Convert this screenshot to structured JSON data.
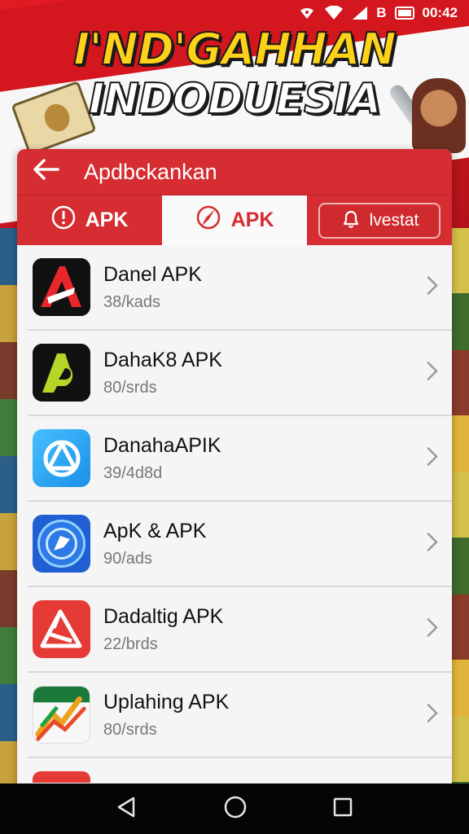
{
  "status_bar": {
    "carrier_glyph": "B",
    "time": "00:42"
  },
  "banner": {
    "line1": "I'ND'GAHHAN",
    "line2": "INDODUESIA"
  },
  "app_bar": {
    "title": "Apdbckankan"
  },
  "tabs": [
    {
      "label": "APK",
      "icon": "alert-circle-icon"
    },
    {
      "label": "APK",
      "icon": "compass-icon"
    },
    {
      "label": "lvestat",
      "icon": "bell-icon"
    }
  ],
  "apps": [
    {
      "name": "Danel APK",
      "sub": "38/kads",
      "icon": "dana-a-red-icon",
      "colors": [
        "#111111",
        "#e8262b"
      ]
    },
    {
      "name": "DahaK8 APK",
      "sub": "80/srds",
      "icon": "dana-a-green-icon",
      "colors": [
        "#111111",
        "#b5d626"
      ]
    },
    {
      "name": "DanahaAPIK",
      "sub": "39/4d8d",
      "icon": "dana-blue-icon",
      "colors": [
        "#2aa7f0",
        "#ffffff"
      ]
    },
    {
      "name": "ApK & APK",
      "sub": "90/ads",
      "icon": "blue-circle-icon",
      "colors": [
        "#1f5fd1",
        "#8fd0ff"
      ]
    },
    {
      "name": "Dadaltig APK",
      "sub": "22/brds",
      "icon": "red-a-icon",
      "colors": [
        "#e53a35",
        "#ffffff"
      ]
    },
    {
      "name": "Uplahing APK",
      "sub": "80/srds",
      "icon": "colorful-chart-icon",
      "colors": [
        "#1da24a",
        "#f0a11a"
      ]
    }
  ],
  "accent_color": "#d52d31"
}
